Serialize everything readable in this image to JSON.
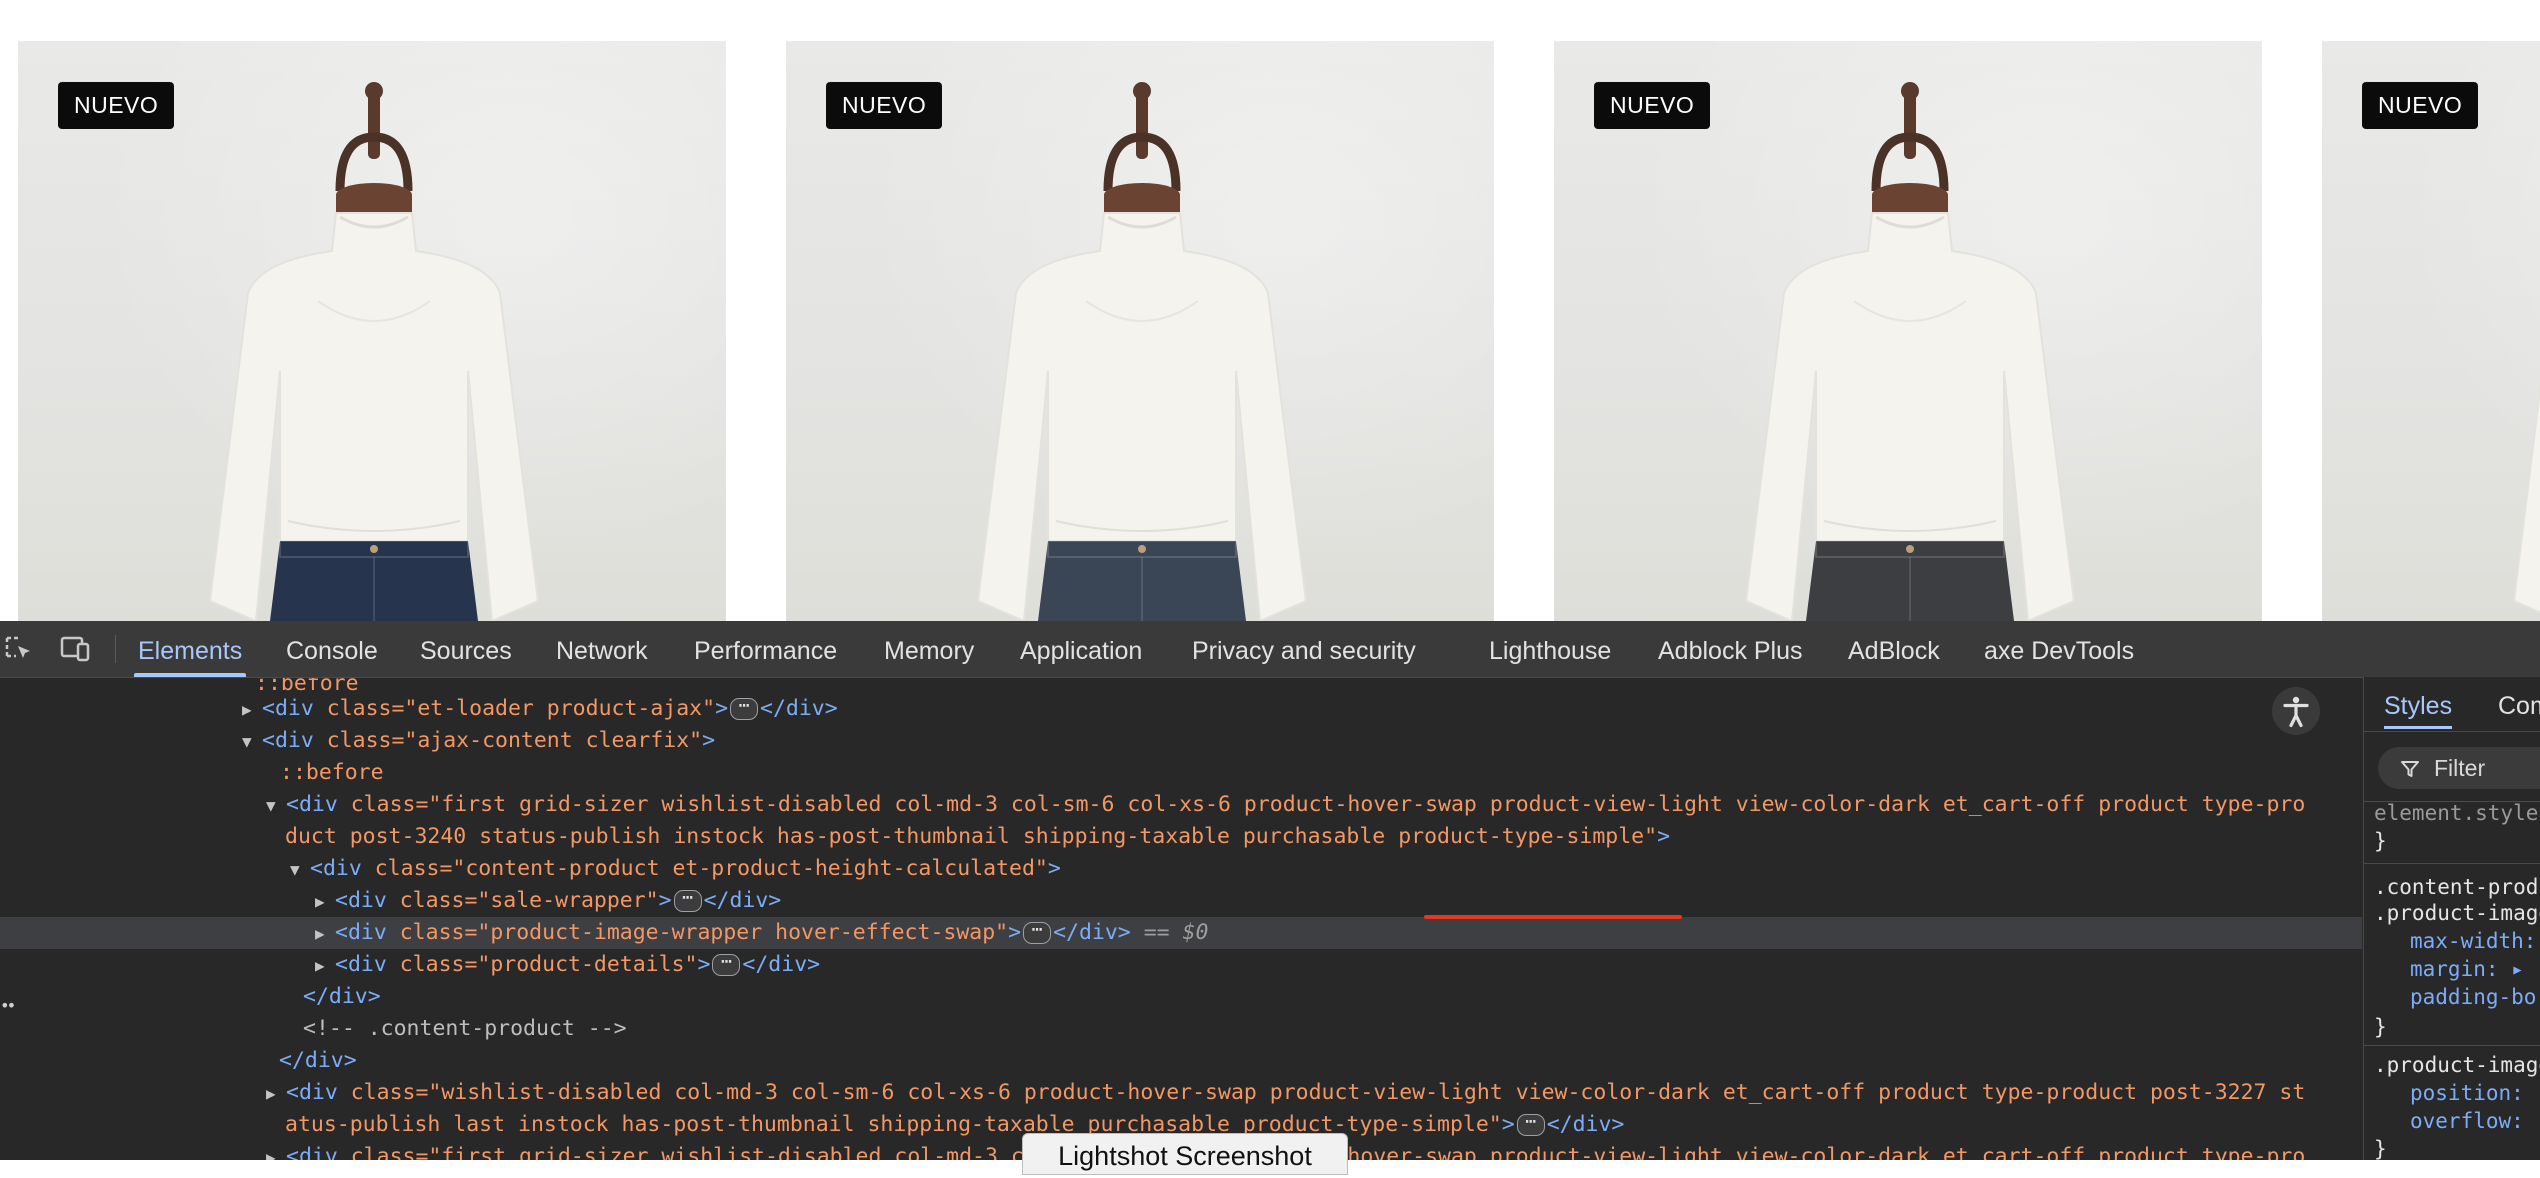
{
  "products": [
    {
      "badge": "NUEVO",
      "jeans": "#27344d"
    },
    {
      "badge": "NUEVO",
      "jeans": "#3a4556"
    },
    {
      "badge": "NUEVO",
      "jeans": "#3c3e42"
    },
    {
      "badge": "NUEVO",
      "jeans": "#2d3a52"
    }
  ],
  "devtools": {
    "tabs": [
      "Elements",
      "Console",
      "Sources",
      "Network",
      "Performance",
      "Memory",
      "Application",
      "Privacy and security",
      "Lighthouse",
      "Adblock Plus",
      "AdBlock",
      "axe DevTools"
    ],
    "active_tab": "Elements",
    "dom": {
      "l0": "::before",
      "l1_tag_open": "<div ",
      "l1_attr": "class=",
      "l1_val": "\"et-loader product-ajax\"",
      "l1_close": "</div>",
      "l2_val": "\"ajax-content clearfix\"",
      "l3": "::before",
      "l4_val": "\"first grid-sizer wishlist-disabled col-md-3 col-sm-6 col-xs-6 product-hover-swap product-view-light view-color-dark et_cart-off product type-pro",
      "l5_val": "duct post-3240 status-publish instock has-post-thumbnail shipping-taxable purchasable product-type-simple\"",
      "l6_val": "\"content-product et-product-height-calculated\"",
      "l7_val": "\"sale-wrapper\"",
      "l8_val": "\"product-image-wrapper hover-effect-swap\"",
      "l8_eq": "== $0",
      "l9_val": "\"product-details\"",
      "l10": "</div>",
      "l11": "<!-- .content-product -->",
      "l12": "</div>",
      "l13_val": "\"wishlist-disabled col-md-3 col-sm-6 col-xs-6 product-hover-swap product-view-light view-color-dark et_cart-off product type-product post-3227 st",
      "l14_val": "atus-publish last instock has-post-thumbnail shipping-taxable purchasable product-type-simple\"",
      "l15_val": "\"first grid-sizer wishlist-disabled col-md-3 col-sm-6 col-xs-6 product-hover-swap product-view-light view-color-dark et_cart-off product type-pro"
    },
    "styles": {
      "tabs": [
        "Styles",
        "Computed"
      ],
      "filter_placeholder": "Filter",
      "element_style": "element.style {",
      "close_brace": "}",
      "rule1_sel1": ".content-product",
      "rule1_sel2": ".product-image",
      "rule1_p1": "max-width:",
      "rule1_p2": "margin: ▸",
      "rule1_p3": "padding-bo",
      "rule2_sel": ".product-image",
      "rule2_p1": "position:",
      "rule2_p2": "overflow:"
    }
  },
  "tooltip": "Lightshot Screenshot"
}
